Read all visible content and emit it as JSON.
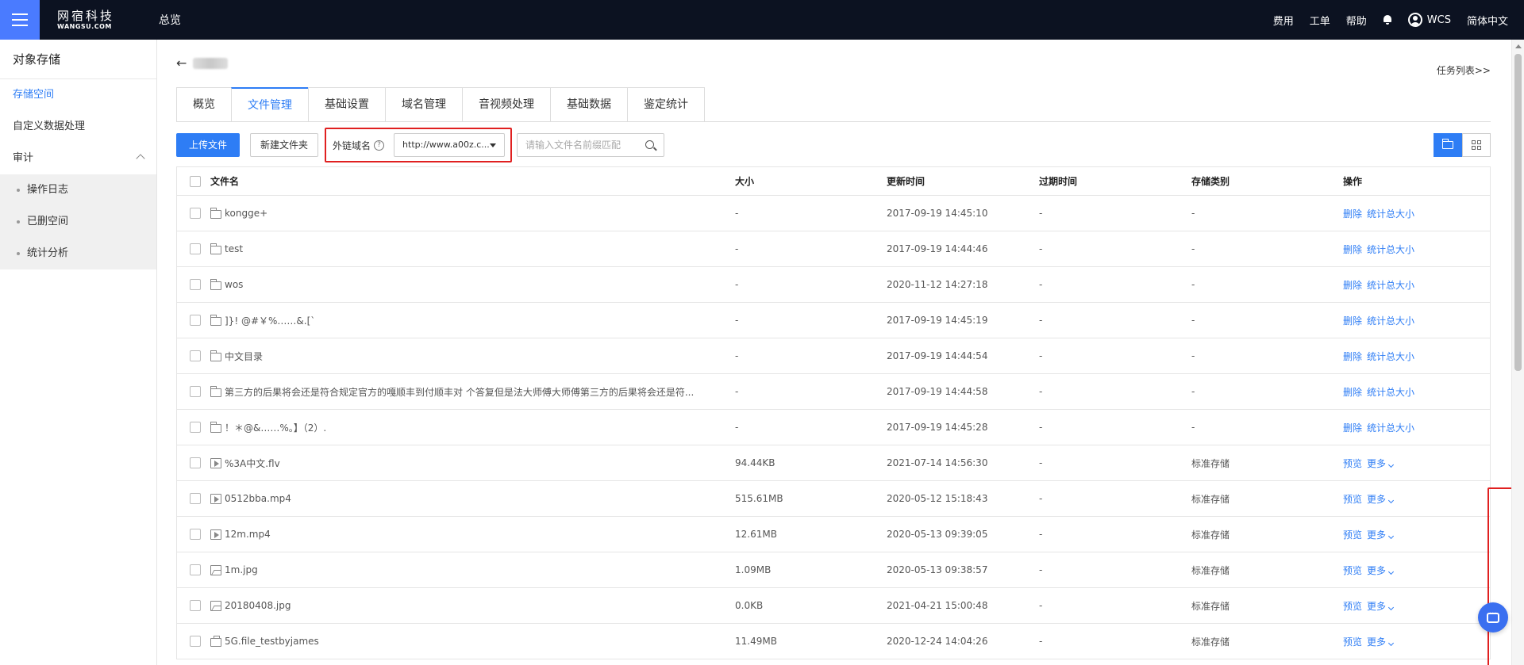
{
  "topbar": {
    "logo_cn": "网宿科技",
    "logo_en": "WANGSU.COM",
    "nav_overview": "总览",
    "links": [
      "费用",
      "工单",
      "帮助"
    ],
    "user": "WCS",
    "language": "简体中文"
  },
  "sidebar": {
    "title": "对象存储",
    "items": [
      "存储空间",
      "自定义数据处理"
    ],
    "audit": "审计",
    "sub_items": [
      "操作日志",
      "已删空间",
      "统计分析"
    ]
  },
  "main": {
    "task_list": "任务列表>>",
    "tabs": [
      "概览",
      "文件管理",
      "基础设置",
      "域名管理",
      "音视频处理",
      "基础数据",
      "鉴定统计"
    ],
    "active_tab": 1,
    "toolbar": {
      "upload": "上传文件",
      "new_folder": "新建文件夹",
      "domain_label": "外链域名",
      "help": "?",
      "domain_value": "http://www.a00z.c...",
      "search_placeholder": "请输入文件名前缀匹配"
    },
    "table": {
      "headers": [
        "文件名",
        "大小",
        "更新时间",
        "过期时间",
        "存储类别",
        "操作"
      ],
      "rows": [
        {
          "icon": "folder",
          "name": "kongge+",
          "size": "-",
          "updated": "2017-09-19 14:45:10",
          "expire": "-",
          "class": "-",
          "ops": [
            "删除",
            "统计总大小"
          ]
        },
        {
          "icon": "folder",
          "name": "test",
          "size": "-",
          "updated": "2017-09-19 14:44:46",
          "expire": "-",
          "class": "-",
          "ops": [
            "删除",
            "统计总大小"
          ]
        },
        {
          "icon": "folder",
          "name": "wos",
          "size": "-",
          "updated": "2020-11-12 14:27:18",
          "expire": "-",
          "class": "-",
          "ops": [
            "删除",
            "统计总大小"
          ]
        },
        {
          "icon": "folder",
          "name": "]}! @#￥%……&.[`",
          "size": "-",
          "updated": "2017-09-19 14:45:19",
          "expire": "-",
          "class": "-",
          "ops": [
            "删除",
            "统计总大小"
          ]
        },
        {
          "icon": "folder",
          "name": "中文目录",
          "size": "-",
          "updated": "2017-09-19 14:44:54",
          "expire": "-",
          "class": "-",
          "ops": [
            "删除",
            "统计总大小"
          ]
        },
        {
          "icon": "folder",
          "name": "第三方的后果将会还是符合规定官方的嘎顺丰到付顺丰对 个答复但是法大师傅大师傅第三方的后果将会还是符...",
          "size": "-",
          "updated": "2017-09-19 14:44:58",
          "expire": "-",
          "class": "-",
          "ops": [
            "删除",
            "统计总大小"
          ]
        },
        {
          "icon": "folder",
          "name": "！＊@&……%。】（2）.",
          "size": "-",
          "updated": "2017-09-19 14:45:28",
          "expire": "-",
          "class": "-",
          "ops": [
            "删除",
            "统计总大小"
          ]
        },
        {
          "icon": "video",
          "name": "%3A中文.flv",
          "size": "94.44KB",
          "updated": "2021-07-14 14:56:30",
          "expire": "-",
          "class": "标准存储",
          "ops": [
            "预览",
            "更多"
          ]
        },
        {
          "icon": "video",
          "name": "0512bba.mp4",
          "size": "515.61MB",
          "updated": "2020-05-12 15:18:43",
          "expire": "-",
          "class": "标准存储",
          "ops": [
            "预览",
            "更多"
          ]
        },
        {
          "icon": "video",
          "name": "12m.mp4",
          "size": "12.61MB",
          "updated": "2020-05-13 09:39:05",
          "expire": "-",
          "class": "标准存储",
          "ops": [
            "预览",
            "更多"
          ]
        },
        {
          "icon": "image",
          "name": "1m.jpg",
          "size": "1.09MB",
          "updated": "2020-05-13 09:38:57",
          "expire": "-",
          "class": "标准存储",
          "ops": [
            "预览",
            "更多"
          ]
        },
        {
          "icon": "image",
          "name": "20180408.jpg",
          "size": "0.0KB",
          "updated": "2021-04-21 15:00:48",
          "expire": "-",
          "class": "标准存储",
          "ops": [
            "预览",
            "更多"
          ]
        },
        {
          "icon": "file",
          "name": "5G.file_testbyjames",
          "size": "11.49MB",
          "updated": "2020-12-24 14:04:26",
          "expire": "-",
          "class": "标准存储",
          "ops": [
            "预览",
            "更多"
          ]
        }
      ]
    }
  },
  "colors": {
    "accent": "#2e7df5",
    "topbar": "#0c1221",
    "menu_button": "#4a7bff",
    "highlight": "#e02020"
  }
}
